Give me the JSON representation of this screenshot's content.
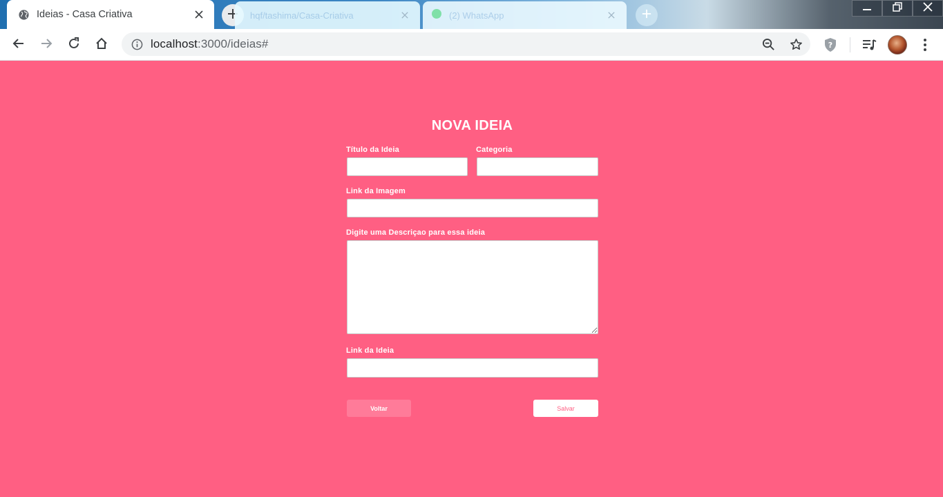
{
  "browser": {
    "active_tab": {
      "title": "Ideias - Casa Criativa"
    },
    "ghost_tabs": [
      {
        "title": "hqf/tashima/Casa-Criativa"
      },
      {
        "title": "(2) WhatsApp"
      }
    ],
    "url": {
      "host": "localhost",
      "path": ":3000/ideias#"
    }
  },
  "form": {
    "heading": "NOVA IDEIA",
    "title_label": "Título da Ideia",
    "category_label": "Categoria",
    "image_label": "Link da Imagem",
    "description_label": "Digite uma Descriçao para essa ideia",
    "link_label": "Link da Ideia",
    "title_value": "",
    "category_value": "",
    "image_value": "",
    "description_value": "",
    "link_value": "",
    "back_label": "Voltar",
    "save_label": "Salvar"
  },
  "colors": {
    "page_background": "#ff5f83",
    "back_button": "#ff7b99",
    "save_text": "#ff5f83"
  },
  "icons": {
    "tab_favicon": "globe-icon",
    "tab_close": "close-icon",
    "new_tab": "plus-icon",
    "back": "arrow-left-icon",
    "forward": "arrow-right-icon",
    "reload": "reload-icon",
    "home": "home-icon",
    "site_info": "info-icon",
    "zoom": "zoom-out-icon",
    "bookmark": "star-icon",
    "extension": "shield-icon",
    "media": "media-playlist-icon",
    "menu": "kebab-menu-icon"
  }
}
